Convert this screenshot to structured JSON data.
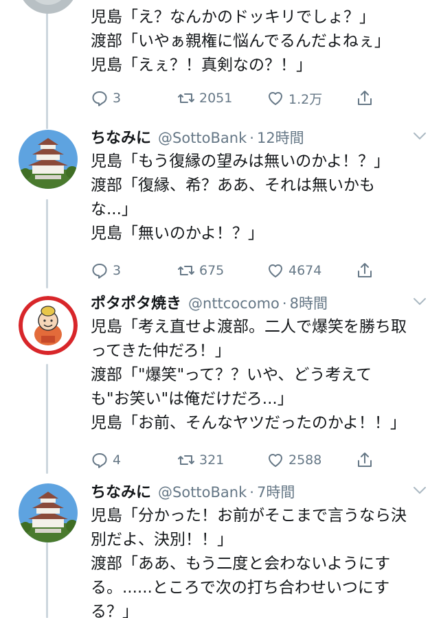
{
  "tweets": [
    {
      "name": "",
      "handle": "",
      "time": "",
      "body": "児島「え？なんかのドッキリでしょ？」\n渡部「いやぁ親権に悩んでるんだよねぇ」\n児島「えぇ？！真剣なの？！」",
      "reply_count": "3",
      "retweet_count": "2051",
      "like_count": "1.2万",
      "avatar_icon": "partial-avatar"
    },
    {
      "name": "ちなみに",
      "handle": "@SottoBank",
      "time": "12時間",
      "body": "児島「もう復縁の望みは無いのかよ！？」\n渡部「復縁、希？ああ、それは無いかも\nな...」\n児島「無いのかよ！？」",
      "reply_count": "3",
      "retweet_count": "675",
      "like_count": "4674",
      "avatar_icon": "castle-avatar"
    },
    {
      "name": "ポタポタ焼き",
      "handle": "@nttcocomo",
      "time": "8時間",
      "body": "児島「考え直せよ渡部。二人で爆笑を勝ち取\nってきた仲だろ！」\n渡部「\"爆笑\"って？？いや、どう考えて\nも\"お笑い\"は俺だけだろ...」\n児島「お前、そんなヤツだったのかよ！！」",
      "reply_count": "4",
      "retweet_count": "321",
      "like_count": "2588",
      "avatar_icon": "cartoon-grandma-avatar"
    },
    {
      "name": "ちなみに",
      "handle": "@SottoBank",
      "time": "7時間",
      "body": "児島「分かった！お前がそこまで言うなら決\n別だよ、決別！！」\n渡部「ああ、もう二度と会わないようにす\nる。......ところで次の打ち合わせいつにす\nる？」",
      "avatar_icon": "castle-avatar"
    }
  ],
  "separator": "·",
  "icons": [
    "reply-icon",
    "retweet-icon",
    "like-icon",
    "share-icon",
    "chevron-down-icon"
  ],
  "colors": {
    "text": "#14171a",
    "muted": "#657786",
    "thread_line": "#ccd6dd"
  }
}
